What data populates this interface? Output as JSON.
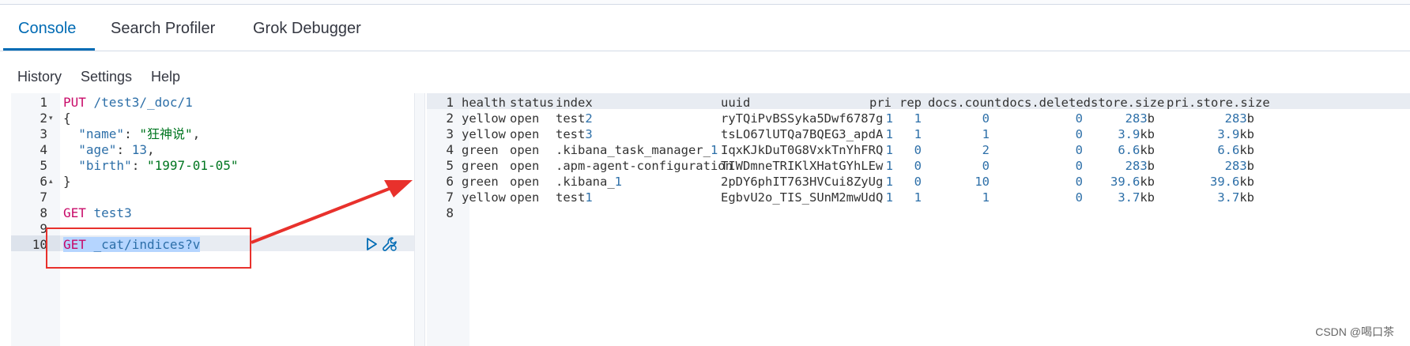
{
  "tabs": [
    "Console",
    "Search Profiler",
    "Grok Debugger"
  ],
  "toolbar": {
    "history": "History",
    "settings": "Settings",
    "help": "Help"
  },
  "editor": {
    "line_numbers": [
      "1",
      "2",
      "3",
      "4",
      "5",
      "6",
      "7",
      "8",
      "9",
      "10"
    ],
    "lines": [
      [
        {
          "t": "PUT ",
          "c": "k-method"
        },
        {
          "t": "/test3/_doc/1",
          "c": "k-url"
        }
      ],
      [
        {
          "t": "{",
          "c": "k-punc"
        }
      ],
      [
        {
          "t": "  ",
          "c": "k-punc"
        },
        {
          "t": "\"name\"",
          "c": "k-url"
        },
        {
          "t": ": ",
          "c": "k-punc"
        },
        {
          "t": "\"狂神说\"",
          "c": "k-str"
        },
        {
          "t": ",",
          "c": "k-punc"
        }
      ],
      [
        {
          "t": "  ",
          "c": "k-punc"
        },
        {
          "t": "\"age\"",
          "c": "k-url"
        },
        {
          "t": ": ",
          "c": "k-punc"
        },
        {
          "t": "13",
          "c": "k-num"
        },
        {
          "t": ",",
          "c": "k-punc"
        }
      ],
      [
        {
          "t": "  ",
          "c": "k-punc"
        },
        {
          "t": "\"birth\"",
          "c": "k-url"
        },
        {
          "t": ": ",
          "c": "k-punc"
        },
        {
          "t": "\"1997-01-05\"",
          "c": "k-str"
        }
      ],
      [
        {
          "t": "}",
          "c": "k-punc"
        }
      ],
      [],
      [
        {
          "t": "GET ",
          "c": "k-method"
        },
        {
          "t": "test3",
          "c": "k-url"
        }
      ],
      [],
      [
        {
          "t": "GET ",
          "c": "k-method sel"
        },
        {
          "t": "_cat/indices?v",
          "c": "k-url sel"
        }
      ]
    ],
    "fold_markers": {
      "2": "▾",
      "6": "▴"
    }
  },
  "output": {
    "line_numbers": [
      "1",
      "2",
      "3",
      "4",
      "5",
      "6",
      "7",
      "8"
    ],
    "columns": [
      "health",
      "status",
      "index",
      "uuid",
      "pri",
      "rep",
      "docs.count",
      "docs.deleted",
      "store.size",
      "pri.store.size"
    ],
    "rows": [
      [
        "yellow",
        "open",
        "test2",
        "ryTQiPvBSSyka5Dwf6787g",
        "1",
        "1",
        "0",
        "0",
        "283b",
        "283b"
      ],
      [
        "yellow",
        "open",
        "test3",
        "tsLO67lUTQa7BQEG3_apdA",
        "1",
        "1",
        "1",
        "0",
        "3.9kb",
        "3.9kb"
      ],
      [
        "green",
        "open",
        ".kibana_task_manager_1",
        "IqxKJkDuT0G8VxkTnYhFRQ",
        "1",
        "0",
        "2",
        "0",
        "6.6kb",
        "6.6kb"
      ],
      [
        "green",
        "open",
        ".apm-agent-configuration",
        "TIWDmneTRIKlXHatGYhLEw",
        "1",
        "0",
        "0",
        "0",
        "283b",
        "283b"
      ],
      [
        "green",
        "open",
        ".kibana_1",
        "2pDY6phIT763HVCui8ZyUg",
        "1",
        "0",
        "10",
        "0",
        "39.6kb",
        "39.6kb"
      ],
      [
        "yellow",
        "open",
        "test1",
        "EgbvU2o_TIS_SUnM2mwUdQ",
        "1",
        "1",
        "1",
        "0",
        "3.7kb",
        "3.7kb"
      ]
    ]
  },
  "icons": {
    "play": "play-icon",
    "wrench": "wrench-icon"
  },
  "annotation_color": "#e8312c",
  "watermark": "CSDN @喝口茶"
}
